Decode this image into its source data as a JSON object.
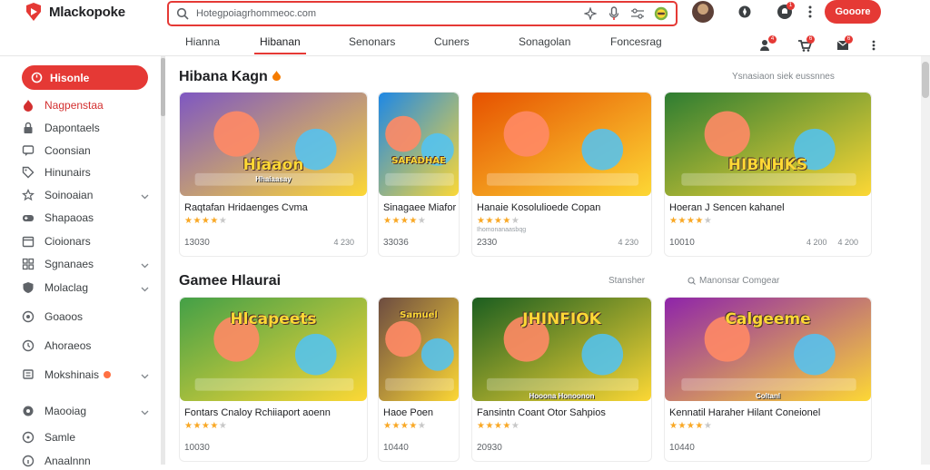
{
  "app": {
    "name": "Mlackopoke",
    "brand_color": "#e53935"
  },
  "search": {
    "value": "Hotegpoiagrhommeoc.com",
    "icons": [
      "search-icon",
      "sparkle-icon",
      "mic-icon",
      "settings-icon",
      "game-icon"
    ]
  },
  "header": {
    "primary_button": "Gooore",
    "badges": {
      "notifications": "1",
      "messages": "1"
    }
  },
  "nav": {
    "tabs": [
      "Hianna",
      "Hibanan",
      "Senonars",
      "Cuners",
      "Sonagolan",
      "Foncesrag"
    ],
    "active_index": 1,
    "badges": {
      "friends": "4",
      "cart": "6",
      "inbox": "6"
    }
  },
  "sidebar": {
    "home": "Hisonle",
    "items": [
      {
        "label": "Nagpenstaa",
        "icon": "flame-icon",
        "red": true
      },
      {
        "label": "Dapontaels",
        "icon": "lock-icon"
      },
      {
        "label": "Coonsian",
        "icon": "chat-icon"
      },
      {
        "label": "Hinunairs",
        "icon": "tag-icon"
      },
      {
        "label": "Soinoaian",
        "icon": "star-icon",
        "chev": true
      },
      {
        "label": "Shapaoas",
        "icon": "gamepad-icon"
      },
      {
        "label": "Cioionars",
        "icon": "calendar-icon"
      },
      {
        "label": "Sgnanaes",
        "icon": "grid-icon",
        "chev": true
      },
      {
        "label": "Molaclag",
        "icon": "shield-icon",
        "chev": true
      },
      {
        "label": "Goaoos",
        "icon": "home-icon"
      },
      {
        "label": "Ahoraeos",
        "icon": "clock-icon"
      },
      {
        "label": "Mokshinais",
        "icon": "trophy-icon",
        "dot": true,
        "chev": true
      },
      {
        "label": "Maooiag",
        "icon": "settings-icon",
        "chev": true
      },
      {
        "label": "Samle",
        "icon": "help-icon"
      },
      {
        "label": "Anaalnnn",
        "icon": "info-icon"
      }
    ]
  },
  "sections": [
    {
      "title": "Hibana Kagn",
      "meta": "Ysnasiaon siek eussnnes",
      "cards": [
        {
          "title": "Raqtafan Hridaenges Cvma",
          "stars": 4,
          "stat": "13030",
          "right": [
            "4 230"
          ],
          "thumb_text": "Hiaaon",
          "thumb_sub": "Hhaiaasay",
          "palette": "#7e57c2"
        },
        {
          "title": "Sinagaee Miafor",
          "stars": 4,
          "stat": "33036",
          "right": [],
          "thumb_text": "SAFADHAE",
          "palette": "#1e88e5"
        },
        {
          "title": "Hanaie Kosolulioede Copan",
          "stars": 4,
          "stat": "2330",
          "sub": "Ihomonanaasbqg",
          "right": [
            "4 230"
          ],
          "thumb_text": "",
          "palette": "#e65100"
        },
        {
          "title": "Hoeran J Sencen kahanel",
          "stars": 4,
          "stat": "10010",
          "right": [
            "4 200",
            "4 200"
          ],
          "thumb_text": "HIBNHKS",
          "palette": "#2e7d32"
        }
      ]
    },
    {
      "title": "Gamee Hlaurai",
      "meta": "Stansher",
      "meta2": "Manonsar Comgear",
      "cards": [
        {
          "title": "Fontars Cnaloy Rchiiaport aoenn",
          "stars": 4,
          "stat": "10030",
          "right": [],
          "thumb_text": "Hlcapeets",
          "palette": "#43a047"
        },
        {
          "title": "Haoe Poen",
          "stars": 4,
          "stat": "10440",
          "right": [],
          "thumb_text": "Samuel",
          "palette": "#6d4c41"
        },
        {
          "title": "Fansintn Coant Otor Sahpios",
          "stars": 4,
          "stat": "20930",
          "right": [],
          "thumb_text": "JHINFIOK",
          "thumb_sub": "Hooona Honoonon",
          "palette": "#1b5e20"
        },
        {
          "title": "Kennatil Haraher Hilant Coneionel",
          "stars": 4,
          "stat": "10440",
          "right": [],
          "thumb_text": "Calgeeme",
          "thumb_sub": "Coltanl",
          "palette": "#8e24aa"
        }
      ]
    }
  ]
}
